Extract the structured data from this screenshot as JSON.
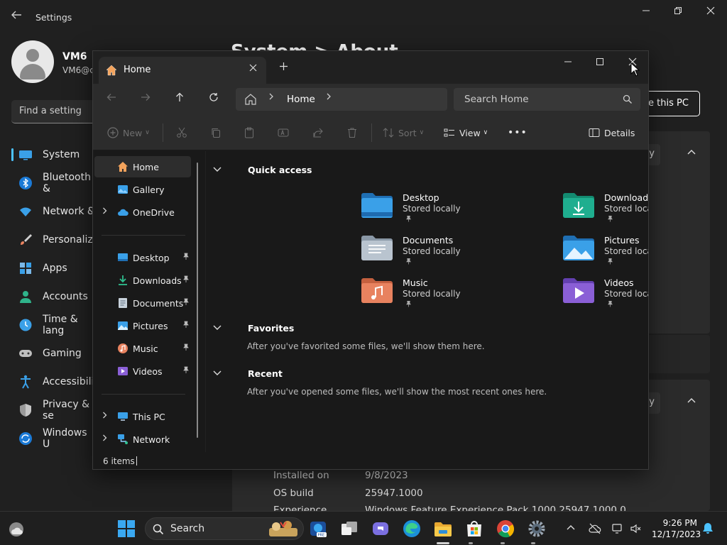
{
  "settings": {
    "title": "Settings",
    "user_name": "VM6",
    "user_email": "VM6@c",
    "search_placeholder": "Find a setting",
    "heading": "System > About",
    "rename_button": "e this PC",
    "copy_button_1": "py",
    "copy_button_2": "py",
    "nav": [
      {
        "label": "System",
        "icon": "system-icon",
        "active": true
      },
      {
        "label": "Bluetooth &",
        "icon": "bluetooth-icon"
      },
      {
        "label": "Network &",
        "icon": "wifi-icon"
      },
      {
        "label": "Personaliza",
        "icon": "brush-icon"
      },
      {
        "label": "Apps",
        "icon": "apps-icon"
      },
      {
        "label": "Accounts",
        "icon": "person-icon"
      },
      {
        "label": "Time & lang",
        "icon": "clock-icon"
      },
      {
        "label": "Gaming",
        "icon": "gamepad-icon"
      },
      {
        "label": "Accessibilit",
        "icon": "accessibility-icon"
      },
      {
        "label": "Privacy & se",
        "icon": "shield-icon"
      },
      {
        "label": "Windows U",
        "icon": "update-icon"
      }
    ],
    "specs": [
      {
        "label": "Installed on",
        "value": "9/8/2023"
      },
      {
        "label": "OS build",
        "value": "25947.1000"
      },
      {
        "label": "Experience",
        "value": "Windows Feature Experience Pack 1000.25947.1000.0"
      }
    ]
  },
  "explorer": {
    "tab_label": "Home",
    "breadcrumb": "Home",
    "search_placeholder": "Search Home",
    "toolbar": {
      "new": "New",
      "sort": "Sort",
      "view": "View",
      "more": "•••",
      "details": "Details"
    },
    "sidebar": {
      "top": [
        {
          "label": "Home",
          "icon": "home-icon",
          "selected": true
        },
        {
          "label": "Gallery",
          "icon": "gallery-icon"
        },
        {
          "label": "OneDrive",
          "icon": "onedrive-icon",
          "expandable": true
        }
      ],
      "pinned": [
        {
          "label": "Desktop",
          "icon": "desktop-folder-icon"
        },
        {
          "label": "Downloads",
          "icon": "downloads-folder-icon"
        },
        {
          "label": "Documents",
          "icon": "documents-folder-icon"
        },
        {
          "label": "Pictures",
          "icon": "pictures-folder-icon"
        },
        {
          "label": "Music",
          "icon": "music-folder-icon"
        },
        {
          "label": "Videos",
          "icon": "videos-folder-icon"
        }
      ],
      "bottom": [
        {
          "label": "This PC",
          "icon": "this-pc-icon"
        },
        {
          "label": "Network",
          "icon": "network-icon"
        }
      ]
    },
    "sections": {
      "quick_access": "Quick access",
      "favorites": "Favorites",
      "favorites_msg": "After you've favorited some files, we'll show them here.",
      "recent": "Recent",
      "recent_msg": "After you've opened some files, we'll show the most recent ones here."
    },
    "quick_access": [
      {
        "name": "Desktop",
        "sub": "Stored locally",
        "icon": "desktop-folder-icon"
      },
      {
        "name": "Downloads",
        "sub": "Stored locally",
        "icon": "downloads-folder-icon"
      },
      {
        "name": "Documents",
        "sub": "Stored locally",
        "icon": "documents-folder-icon"
      },
      {
        "name": "Pictures",
        "sub": "Stored locally",
        "icon": "pictures-folder-icon"
      },
      {
        "name": "Music",
        "sub": "Stored locally",
        "icon": "music-folder-icon"
      },
      {
        "name": "Videos",
        "sub": "Stored locally",
        "icon": "videos-folder-icon"
      }
    ],
    "status": "6 items"
  },
  "taskbar": {
    "search_label": "Search",
    "time": "9:26 PM",
    "date": "12/17/2023"
  },
  "colors": {
    "accent": "#4cc2ff",
    "folder_blue": "#2f8fd8",
    "downloads_teal": "#1fae8f",
    "music_orange": "#e8825f",
    "videos_purple": "#8a5fd6"
  }
}
